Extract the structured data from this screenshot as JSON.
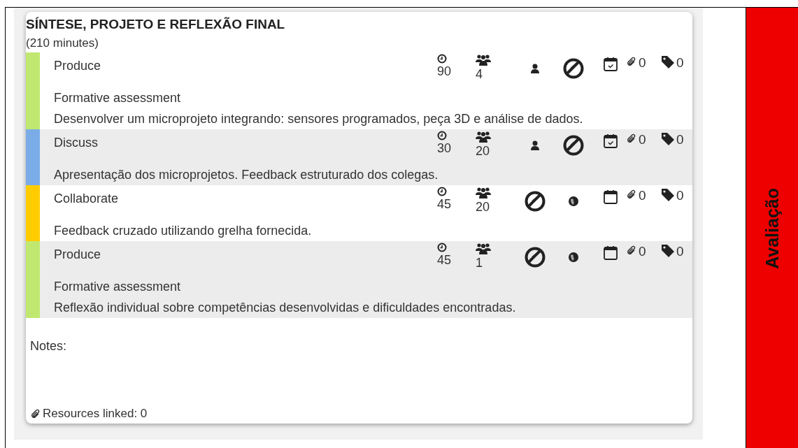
{
  "section": {
    "title": "SÍNTESE, PROJETO E REFLEXÃO FINAL",
    "duration": "(210 minutes)"
  },
  "activities": [
    {
      "type": "Produce",
      "color": "#c0e870",
      "duration": "90",
      "group_size": "4",
      "modes": [
        {
          "kind": "person"
        },
        {
          "kind": "dial"
        }
      ],
      "scheduled": true,
      "attachments": "0",
      "tags": "0",
      "assessment": "Formative assessment",
      "description": "Desenvolver um microprojeto integrando: sensores programados, peça 3D e análise de dados.",
      "shaded": false
    },
    {
      "type": "Discuss",
      "color": "#7aade8",
      "duration": "30",
      "group_size": "20",
      "modes": [
        {
          "kind": "person"
        },
        {
          "kind": "dial"
        }
      ],
      "scheduled": true,
      "attachments": "0",
      "tags": "0",
      "description": "Apresentação dos microprojetos. Feedback estruturado dos colegas.",
      "shaded": true
    },
    {
      "type": "Collaborate",
      "color": "#ffcc00",
      "duration": "45",
      "group_size": "20",
      "modes": [
        {
          "kind": "dial"
        },
        {
          "kind": "globe"
        }
      ],
      "scheduled": false,
      "attachments": "0",
      "tags": "0",
      "description": "Feedback cruzado utilizando grelha fornecida.",
      "shaded": false
    },
    {
      "type": "Produce",
      "color": "#c0e870",
      "duration": "45",
      "group_size": "1",
      "modes": [
        {
          "kind": "dial"
        },
        {
          "kind": "globe"
        }
      ],
      "scheduled": false,
      "attachments": "0",
      "tags": "0",
      "assessment": "Formative assessment",
      "description": "Reflexão individual sobre competências desenvolvidas e dificuldades encontradas.",
      "shaded": true
    }
  ],
  "notes_label": "Notes:",
  "resources": "Resources linked: 0",
  "side_label": "Avaliação"
}
